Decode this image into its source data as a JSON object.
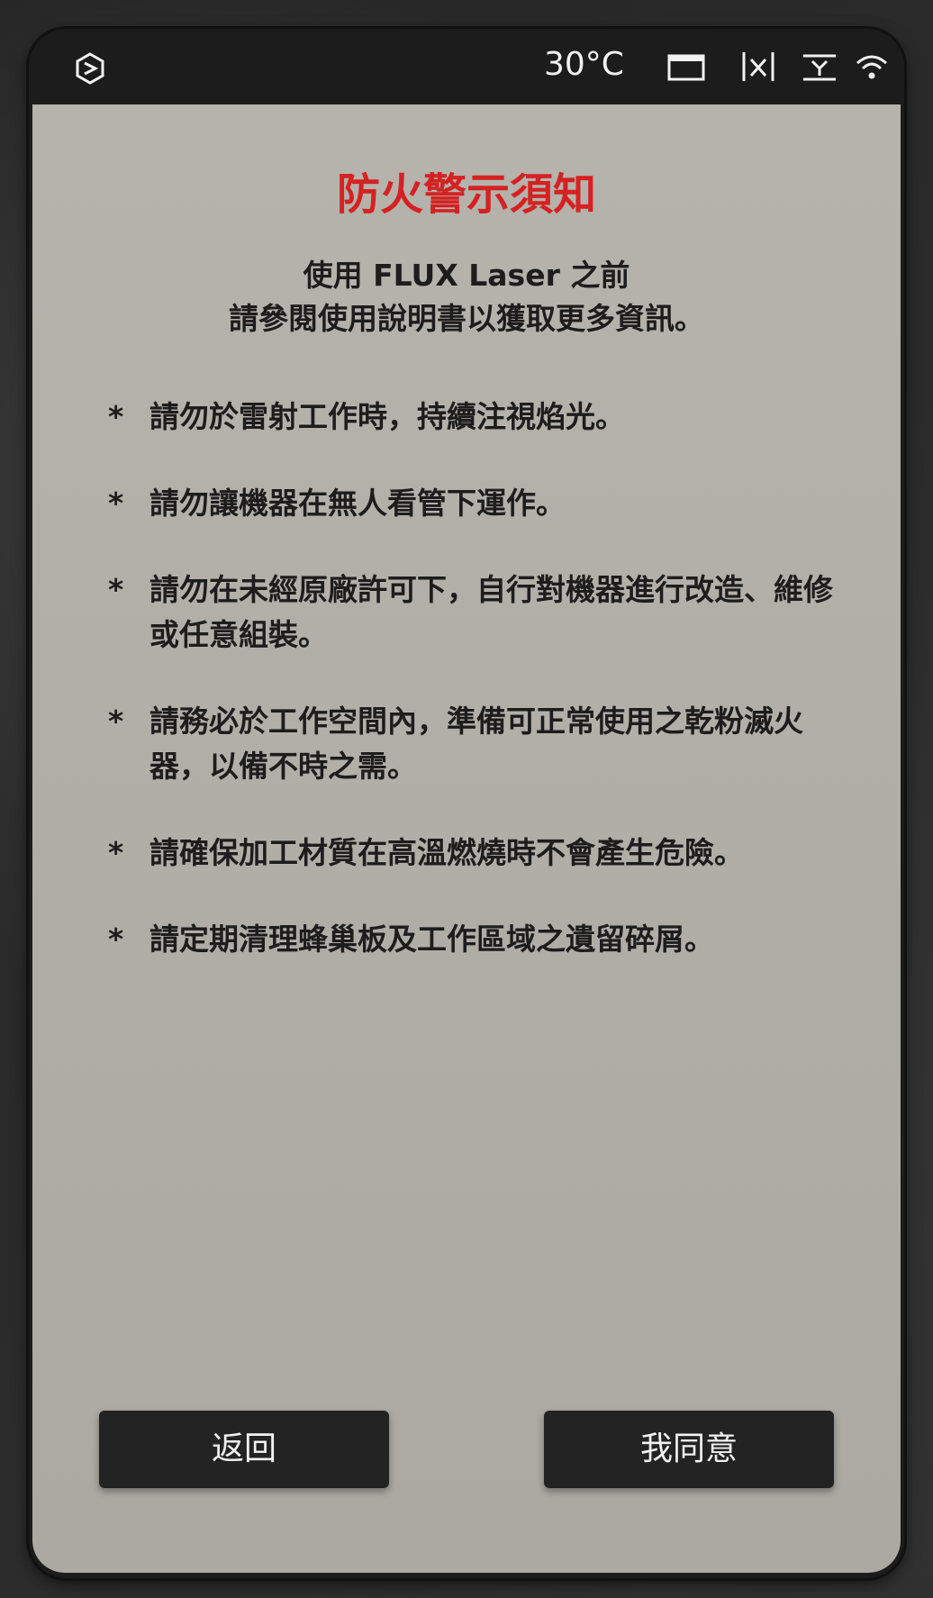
{
  "status_bar": {
    "temperature": "30°C",
    "icons": [
      "flux-logo-icon",
      "camera-screen-icon",
      "x-axis-icon",
      "z-axis-icon",
      "wifi-icon"
    ]
  },
  "notice": {
    "title": "防火警示須知",
    "intro_line1": "使用 FLUX Laser 之前",
    "intro_line2": "請參閱使用說明書以獲取更多資訊。",
    "bullet": "*",
    "rules": [
      "請勿於雷射工作時，持續注視焰光。",
      "請勿讓機器在無人看管下運作。",
      "請勿在未經原廠許可下，自行對機器進行改造、維修或任意組裝。",
      "請務必於工作空間內，準備可正常使用之乾粉滅火器，以備不時之需。",
      "請確保加工材質在高溫燃燒時不會產生危險。",
      "請定期清理蜂巢板及工作區域之遺留碎屑。"
    ]
  },
  "buttons": {
    "back_label": "返回",
    "agree_label": "我同意"
  },
  "colors": {
    "title_red": "#d42222",
    "screen_gray": "#b3b0aa",
    "button_dark": "#232323",
    "status_bar": "#1c1c1c"
  }
}
